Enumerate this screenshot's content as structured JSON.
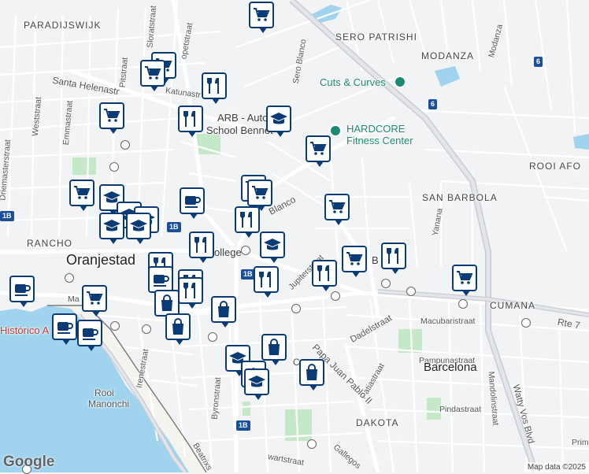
{
  "labels": {
    "paradijswijk": "PARADIJSWIJK",
    "sero_patrishi": "SERO PATRISHI",
    "modanza": "MODANZA",
    "modanza_road": "Modanza",
    "santa_helena": "Santa Helenastr",
    "katunastraat": "Katunastr",
    "sero_blanco": "Sero Blanco",
    "rooi_afo": "ROOI AFO",
    "san_barbola": "SAN BARBOLA",
    "yanana": "Yanana",
    "rancho": "RANCHO",
    "oranjestad": "Oranjestad",
    "cumana": "CUMANA",
    "rte7": "Rte 7",
    "dadelstraat": "Dadelstraat",
    "macubaristraat": "Macubaristraat",
    "pampunastraat": "Pampunastraat",
    "barcelona": "Barcelona",
    "patiastraat": "Patiastraat",
    "pindastraat": "Pindastraat",
    "dakota": "DAKOTA",
    "papa_juan": "Papa Juan Pablo II",
    "irenestraat": "Irenestraat",
    "byronstraat": "Byronstraat",
    "rooi_manonchi_1": "Rooi",
    "rooi_manonchi_2": "Manonchi",
    "historico": "Histórico A",
    "watty_vos": "Watty Vos Blvd",
    "mandolinstraat": "Mandolinstraat",
    "jupiterstraat": "Jupiterstraat",
    "blanco": "Blanco",
    "weststraat": "Weststraat",
    "emmastraat": "Emmastraat",
    "driemasterstraat": "Driemasterstraat",
    "sloratstraat": "Sloratstraat",
    "pitstraat": "Pitstraat",
    "opetstraat": "opetstraat",
    "beatrix": "Beatrixs",
    "gallegos": "Gallegos",
    "swartstraat": "wartstraat",
    "ballege": "B",
    "ollege": "ollege",
    "arb_line1": "ARB - Auto",
    "arb_line2": "School Bennet",
    "cuts_curves": "Cuts & Curves",
    "hardcore_1": "HARDCORE",
    "hardcore_2": "Fitness Center",
    "b_letter": "B",
    "prim": "Prim",
    "ma": "Ma",
    "ca": "Ca"
  },
  "shields": [
    "6",
    "6",
    "1B",
    "1B",
    "1B",
    "1B"
  ],
  "footer": {
    "logo": "Google",
    "attribution": "Map data ©2025"
  }
}
